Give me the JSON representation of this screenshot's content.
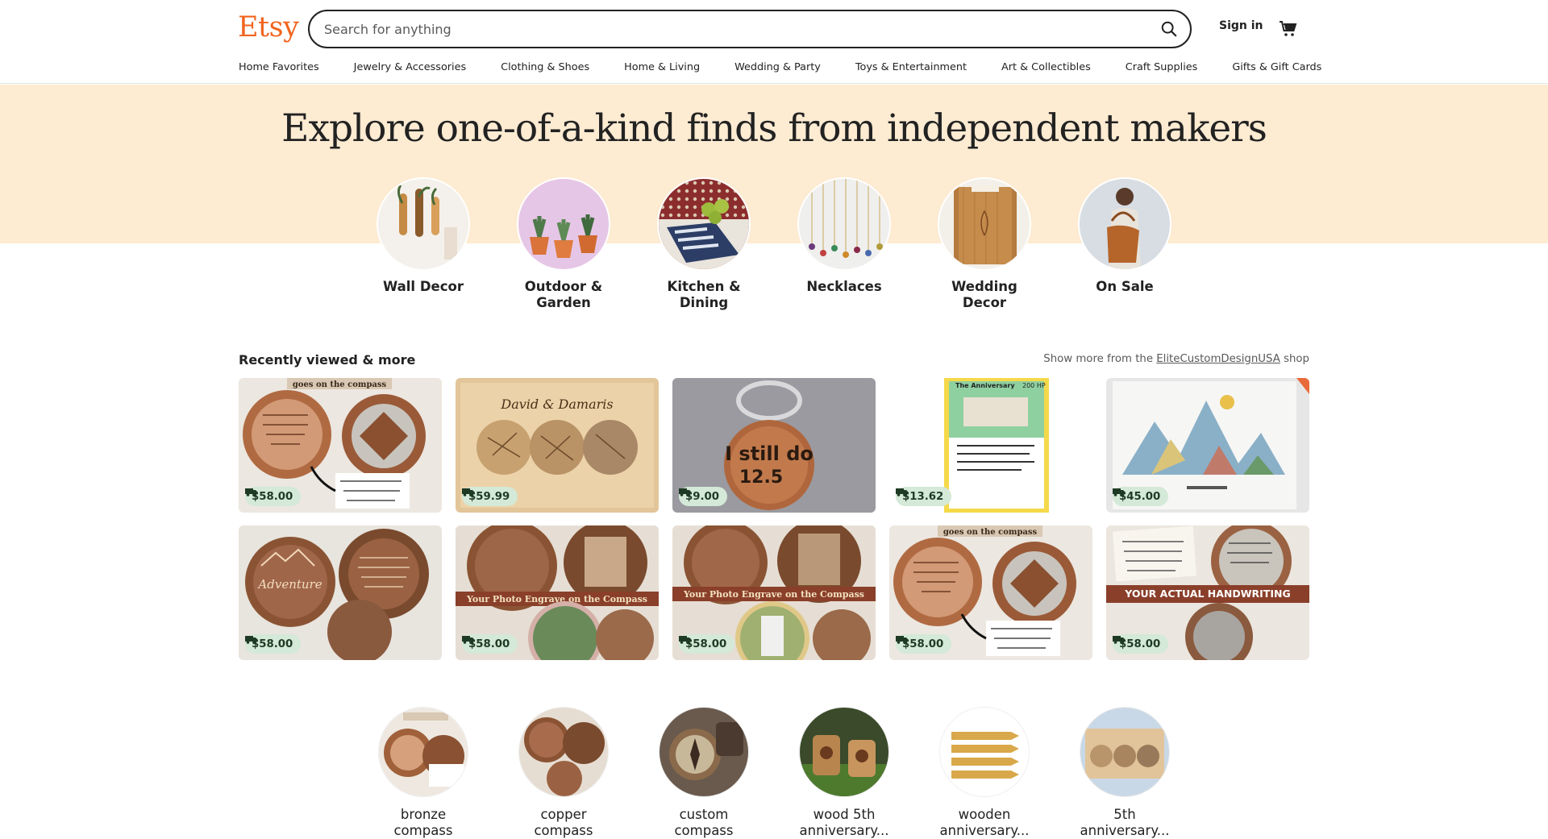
{
  "header": {
    "logo": "Etsy",
    "search_placeholder": "Search for anything",
    "signin": "Sign in"
  },
  "nav": [
    "Home Favorites",
    "Jewelry & Accessories",
    "Clothing & Shoes",
    "Home & Living",
    "Wedding & Party",
    "Toys & Entertainment",
    "Art & Collectibles",
    "Craft Supplies",
    "Gifts & Gift Cards"
  ],
  "hero": {
    "title": "Explore one-of-a-kind finds from independent makers"
  },
  "categories": [
    {
      "label": "Wall Decor"
    },
    {
      "label": "Outdoor & Garden"
    },
    {
      "label": "Kitchen & Dining"
    },
    {
      "label": "Necklaces"
    },
    {
      "label": "Wedding Decor"
    },
    {
      "label": "On Sale"
    }
  ],
  "recent": {
    "title": "Recently viewed & more",
    "more_prefix": "Show more from the",
    "shop": "EliteCustomDesignUSA",
    "more_suffix": "shop",
    "items": [
      {
        "price": "$58.00"
      },
      {
        "price": "$59.99"
      },
      {
        "price": "$9.00"
      },
      {
        "price": "$13.62"
      },
      {
        "price": "$45.00"
      },
      {
        "price": "$58.00"
      },
      {
        "price": "$58.00"
      },
      {
        "price": "$58.00"
      },
      {
        "price": "$58.00"
      },
      {
        "price": "$58.00"
      }
    ],
    "tile_text": {
      "t1_banner": "goes on the compass",
      "t2_names": "David & Damaris",
      "t3_text": "I still do",
      "t3_num": "12.5",
      "t4_title": "The Anniversary",
      "t4_hp": "200 HP",
      "t6_text": "Adventure",
      "t7_banner": "Your Photo Engrave on the Compass",
      "t8_banner": "Your Photo Engrave on the Compass",
      "t9_banner": "goes on the compass",
      "t10_banner": "YOUR ACTUAL HANDWRITING"
    }
  },
  "related": [
    {
      "line1": "bronze",
      "line2": "compass"
    },
    {
      "line1": "copper",
      "line2": "compass"
    },
    {
      "line1": "custom",
      "line2": "compass"
    },
    {
      "line1": "wood 5th",
      "line2": "anniversary..."
    },
    {
      "line1": "wooden",
      "line2": "anniversary..."
    },
    {
      "line1": "5th",
      "line2": "anniversary..."
    }
  ],
  "colors": {
    "brand": "#f1641e",
    "hero_bg": "#fdebd2",
    "price_badge": "#d4e9d7"
  }
}
